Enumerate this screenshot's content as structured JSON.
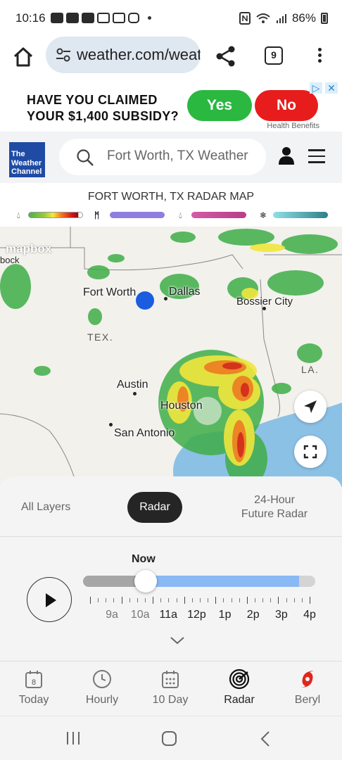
{
  "status_bar": {
    "time": "10:16",
    "battery": "86%",
    "left_icons": [
      "youtube-icon",
      "youtube-icon",
      "youtube-icon",
      "news-icon",
      "news-icon",
      "instagram-icon"
    ],
    "right_icons": [
      "nfc-icon",
      "wifi-icon",
      "signal-icon",
      "battery-icon"
    ]
  },
  "browser": {
    "url": "weather.com/weather/radar",
    "tab_count": "9"
  },
  "ad": {
    "headline_line1": "HAVE YOU CLAIMED",
    "headline_line2": "YOUR $1,400 SUBSIDY?",
    "yes_label": "Yes",
    "no_label": "No",
    "sponsor": "Health Benefits",
    "colors": {
      "yes": "#2ab840",
      "no": "#e71d1d"
    }
  },
  "header": {
    "logo_line1": "The",
    "logo_line2": "Weather",
    "logo_line3": "Channel",
    "search_placeholder": "Fort Worth, TX Weather",
    "brand_color": "#1f4ba5"
  },
  "legend": {
    "title": "FORT WORTH, TX RADAR MAP",
    "items": [
      {
        "icon": "rain-drop-icon",
        "colors": [
          "#4caf50",
          "#f2e93b",
          "#f57c1f",
          "#d4171a",
          "#8a1010"
        ]
      },
      {
        "icon": "ice-icon",
        "colors": [
          "#8f7ee0",
          "#8f7ee0"
        ]
      },
      {
        "icon": "mix-drop-icon",
        "colors": [
          "#d055a0",
          "#b83e88"
        ]
      },
      {
        "icon": "snowflake-icon",
        "colors": [
          "#7bd6de",
          "#2f7f88"
        ]
      }
    ]
  },
  "map": {
    "attribution": "mapbox",
    "partial_label": "bock",
    "cities": [
      "Fort Worth",
      "Dallas",
      "Bossier City",
      "Austin",
      "Houston",
      "San Antonio"
    ],
    "regions": [
      "TEX.",
      "LA."
    ]
  },
  "layers": {
    "all_layers": "All Layers",
    "radar": "Radar",
    "future_line1": "24-Hour",
    "future_line2": "Future Radar"
  },
  "timeline": {
    "current_label": "Now",
    "labels": [
      "9a",
      "10a",
      "11a",
      "12p",
      "1p",
      "2p",
      "3p",
      "4p"
    ],
    "progress": 0.27,
    "future_end": 0.93
  },
  "nav": {
    "today_date": "8",
    "items": [
      {
        "label": "Today",
        "icon": "calendar-icon"
      },
      {
        "label": "Hourly",
        "icon": "clock-icon"
      },
      {
        "label": "10 Day",
        "icon": "calendar-grid-icon"
      },
      {
        "label": "Radar",
        "icon": "radar-icon"
      },
      {
        "label": "Beryl",
        "icon": "hurricane-icon"
      }
    ],
    "accent": "#e0261c"
  }
}
